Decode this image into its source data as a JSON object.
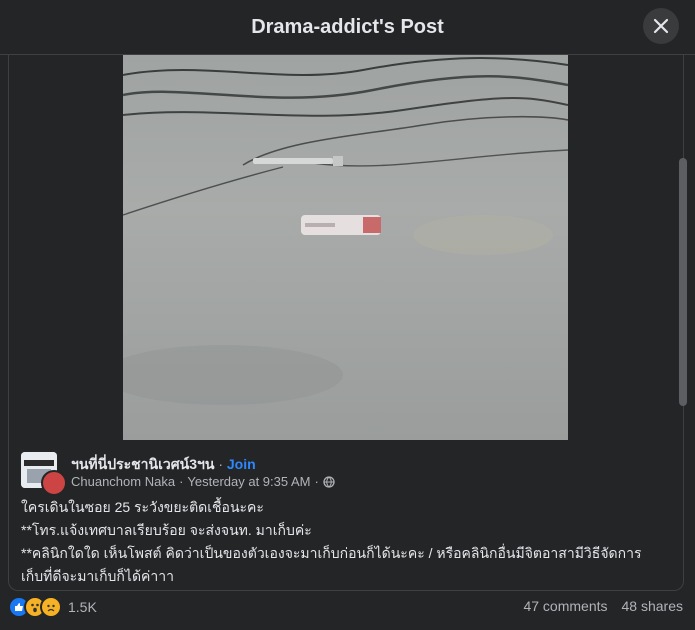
{
  "header": {
    "title": "Drama-addict's Post"
  },
  "post": {
    "group_name": "ฯนที่นี่ประชานิเวศน์3ฯน",
    "join_label": "Join",
    "author": "Chuanchom Naka",
    "time": "Yesterday at 9:35 AM",
    "text_lines": [
      "ใครเดินในซอย 25 ระวังขยะติดเชื้อนะคะ",
      "**โทร.แจ้งเทศบาลเรียบร้อย จะส่งจนท. มาเก็บค่ะ",
      "**คลินิกใดใด เห็นโพสต์ คิดว่าเป็นของตัวเองจะมาเก็บก่อนก็ได้นะคะ / หรือคลินิกอื่นมีจิตอาสามีวิธีจัดการ",
      "เก็บที่ดีจะมาเก็บก็ได้ค่าาา"
    ]
  },
  "footer": {
    "reaction_count": "1.5K",
    "comments": "47 comments",
    "shares": "48 shares"
  },
  "icons": {
    "close": "close-icon",
    "globe": "globe-icon",
    "like": "like-reaction-icon",
    "wow": "wow-reaction-icon",
    "sad": "sad-reaction-icon"
  },
  "colors": {
    "background": "#242526",
    "link": "#2d88ff",
    "like": "#1877f2"
  }
}
